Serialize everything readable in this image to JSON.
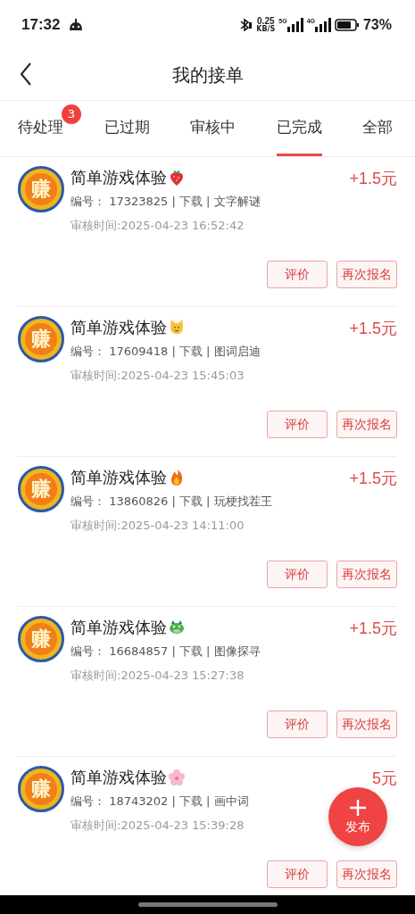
{
  "status_bar": {
    "time": "17:32",
    "speed": "0.25",
    "speed_unit": "KB/S",
    "net_1": "5G",
    "net_2": "4G",
    "battery": "73%"
  },
  "header": {
    "title": "我的接单"
  },
  "tabs": [
    {
      "label": "待处理",
      "selected": false,
      "badge": "3"
    },
    {
      "label": "已过期",
      "selected": false
    },
    {
      "label": "审核中",
      "selected": false
    },
    {
      "label": "已完成",
      "selected": true
    },
    {
      "label": "全部",
      "selected": false
    }
  ],
  "orders": [
    {
      "avatar_text": "赚",
      "title": "简单游戏体验",
      "kind": "strawberry",
      "reward": "+1.5元",
      "number_label": "编号：",
      "meta": "17323825 | 下载 | 文字解谜",
      "review_time": "审核时间:2025-04-23 16:52:42",
      "buttons": [
        "评价",
        "再次报名"
      ]
    },
    {
      "avatar_text": "赚",
      "title": "简单游戏体验",
      "kind": "cat",
      "reward": "+1.5元",
      "number_label": "编号：",
      "meta": "17609418 | 下载 | 图词启迪",
      "review_time": "审核时间:2025-04-23 15:45:03",
      "buttons": [
        "评价",
        "再次报名"
      ]
    },
    {
      "avatar_text": "赚",
      "title": "简单游戏体验",
      "kind": "fire",
      "reward": "+1.5元",
      "number_label": "编号：",
      "meta": "13860826 | 下载 | 玩梗找茬王",
      "review_time": "审核时间:2025-04-23 14:11:00",
      "buttons": [
        "评价",
        "再次报名"
      ]
    },
    {
      "avatar_text": "赚",
      "title": "简单游戏体验",
      "kind": "dragon",
      "reward": "+1.5元",
      "number_label": "编号：",
      "meta": "16684857 | 下载 | 图像探寻",
      "review_time": "审核时间:2025-04-23 15:27:38",
      "buttons": [
        "评价",
        "再次报名"
      ]
    },
    {
      "avatar_text": "赚",
      "title": "简单游戏体验",
      "kind": "blossom",
      "reward": "5元",
      "number_label": "编号：",
      "meta": "18743202 | 下载 | 画中词",
      "review_time": "审核时间:2025-04-23 15:39:28",
      "buttons": [
        "评价",
        "再次报名"
      ]
    }
  ],
  "fab": {
    "label": "发布"
  }
}
